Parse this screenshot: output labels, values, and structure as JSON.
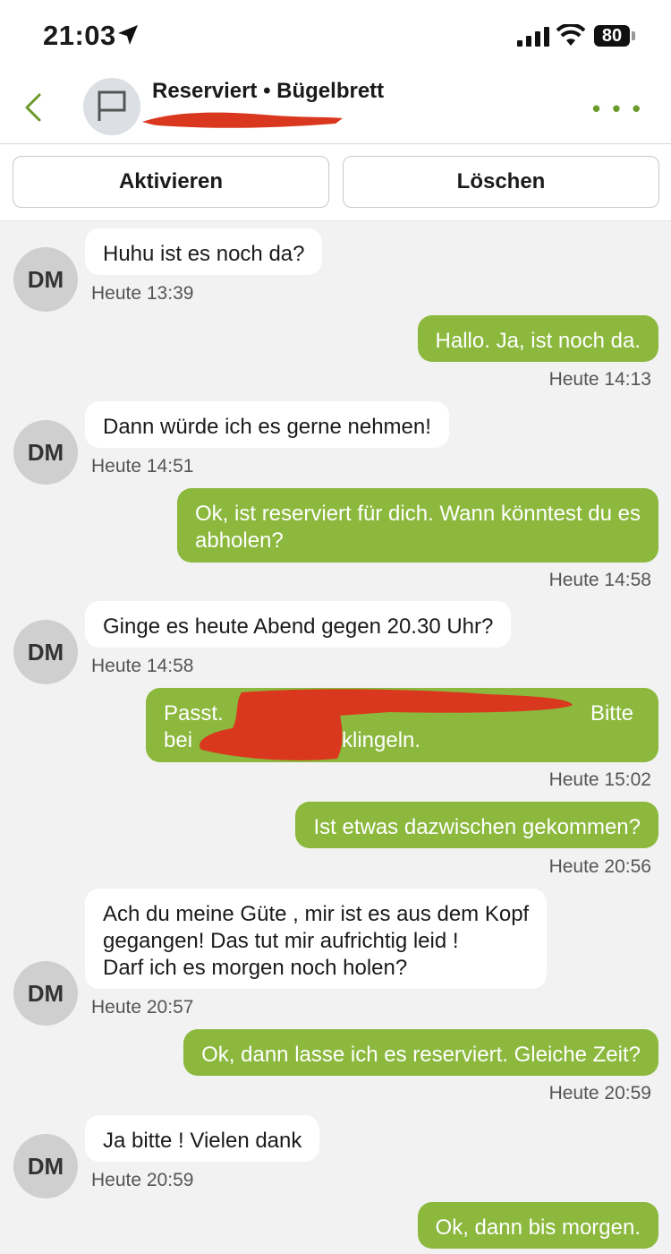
{
  "status_bar": {
    "time": "21:03",
    "battery": "80"
  },
  "header": {
    "title": "Reserviert • Bügelbrett",
    "subtitle": ""
  },
  "actions": {
    "activate_label": "Aktivieren",
    "delete_label": "Löschen"
  },
  "contact": {
    "initials": "DM"
  },
  "messages": [
    {
      "dir": "in",
      "lines": [
        "Huhu ist es noch da?"
      ],
      "time": "Heute 13:39"
    },
    {
      "dir": "out",
      "lines": [
        "Hallo. Ja, ist noch da."
      ],
      "time": "Heute 14:13"
    },
    {
      "dir": "in",
      "lines": [
        "Dann würde ich es gerne nehmen!"
      ],
      "time": "Heute 14:51"
    },
    {
      "dir": "out",
      "lines": [
        "Ok, ist reserviert für dich. Wann könntest du es",
        "abholen?"
      ],
      "time": "Heute 14:58"
    },
    {
      "dir": "in",
      "lines": [
        "Ginge es heute Abend gegen 20.30 Uhr?"
      ],
      "time": "Heute 14:58"
    },
    {
      "dir": "out",
      "lines": [
        "Passt.",
        "Bitte",
        "bei",
        "klingeln."
      ],
      "time": "Heute 15:02"
    },
    {
      "dir": "out",
      "lines": [
        "Ist etwas dazwischen gekommen?"
      ],
      "time": "Heute 20:56"
    },
    {
      "dir": "in",
      "lines": [
        "Ach du meine Güte , mir ist es aus dem Kopf",
        "gegangen! Das tut mir aufrichtig leid !",
        "Darf ich es morgen noch holen?"
      ],
      "time": "Heute 20:57"
    },
    {
      "dir": "out",
      "lines": [
        "Ok, dann lasse ich es reserviert. Gleiche Zeit?"
      ],
      "time": "Heute 20:59"
    },
    {
      "dir": "in",
      "lines": [
        "Ja bitte ! Vielen dank"
      ],
      "time": "Heute 20:59"
    },
    {
      "dir": "out",
      "lines": [
        "Ok, dann bis morgen."
      ],
      "time": ""
    }
  ],
  "colors": {
    "accent": "#8bb83d",
    "redaction": "#d9381e",
    "incoming_bg": "#ffffff",
    "chat_bg": "#f2f2f2"
  },
  "icons": [
    "location-arrow-icon",
    "signal-icon",
    "wifi-icon",
    "battery-icon",
    "back-chevron-icon",
    "flag-icon",
    "more-icon"
  ]
}
